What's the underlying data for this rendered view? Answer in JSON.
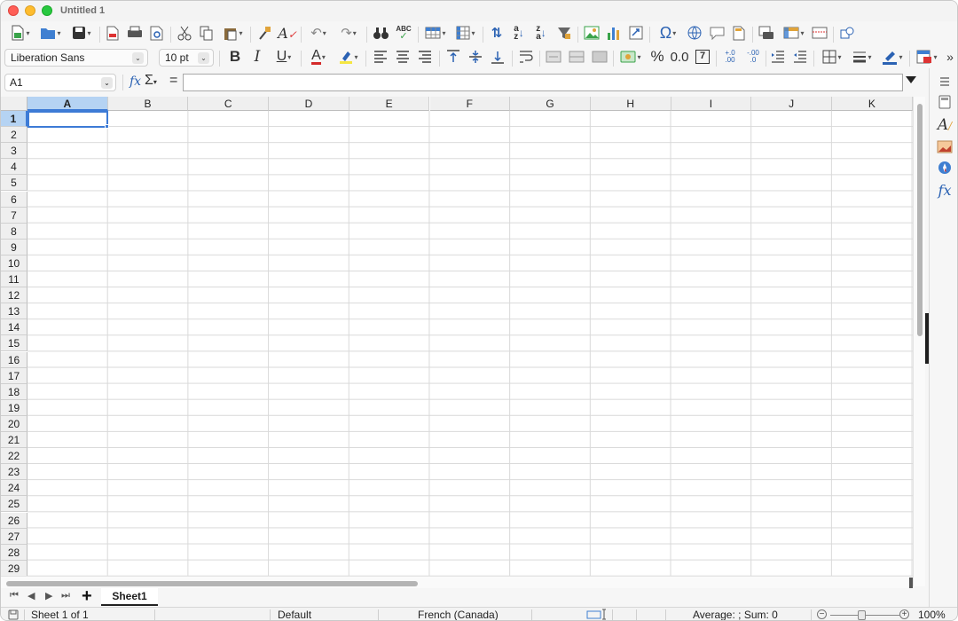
{
  "window": {
    "title": "Untitled 1"
  },
  "toolbar_standard": {
    "icons": [
      "new-document-icon",
      "open-folder-icon",
      "save-icon",
      "export-pdf-icon",
      "print-icon",
      "print-preview-icon",
      "cut-icon",
      "copy-icon",
      "paste-icon",
      "clone-formatting-icon",
      "clear-formatting-icon",
      "undo-icon",
      "redo-icon",
      "find-replace-icon",
      "spelling-icon",
      "row-icon",
      "column-icon",
      "sort-icon",
      "sort-ascending-icon",
      "sort-descending-icon",
      "autofilter-icon",
      "image-icon",
      "chart-icon",
      "pivot-table-icon",
      "special-character-icon",
      "hyperlink-icon",
      "comment-icon",
      "headers-footers-icon",
      "define-print-area-icon",
      "freeze-rows-columns-icon",
      "split-window-icon",
      "show-draw-functions-icon"
    ],
    "labels": {
      "spelling_text": "ABC",
      "sort_az_text": "A\nZ",
      "omega": "Ω"
    }
  },
  "toolbar_formatting": {
    "font_name": "Liberation Sans",
    "font_size": "10 pt",
    "bold": "B",
    "italic": "I",
    "underline": "U",
    "font_color_letter": "A",
    "font_color": "#d42a2a",
    "highlight_color": "#f5e642",
    "percent": "%",
    "decimal_format": "0.0",
    "number_format": "7",
    "add_decimal": "+.0\n.00",
    "remove_decimal": "-.00\n.0",
    "more": "»"
  },
  "formula_bar": {
    "name_box": "A1",
    "fx": "fx",
    "sigma": "Σ",
    "equals": "=",
    "input_value": ""
  },
  "grid": {
    "columns": [
      "A",
      "B",
      "C",
      "D",
      "E",
      "F",
      "G",
      "H",
      "I",
      "J",
      "K"
    ],
    "rows": [
      "1",
      "2",
      "3",
      "4",
      "5",
      "6",
      "7",
      "8",
      "9",
      "10",
      "11",
      "12",
      "13",
      "14",
      "15",
      "16",
      "17",
      "18",
      "19",
      "20",
      "21",
      "22",
      "23",
      "24",
      "25",
      "26",
      "27",
      "28",
      "29"
    ],
    "active_column": "A",
    "active_row": "1",
    "selection_color": "#3d7bd6",
    "header_highlight": "#b5d3f3"
  },
  "sheet_tabs": {
    "add_label": "+",
    "tabs": [
      "Sheet1"
    ]
  },
  "status_bar": {
    "sheet_position": "Sheet 1 of 1",
    "page_style": "Default",
    "language": "French (Canada)",
    "summary": "Average: ; Sum: 0",
    "zoom": "100%",
    "zoom_minus": "−",
    "zoom_plus": "+"
  },
  "sidebar": {
    "icons": [
      "sidebar-menu-icon",
      "properties-icon",
      "styles-icon",
      "gallery-icon",
      "navigator-icon",
      "functions-icon"
    ],
    "functions_label": "fx"
  }
}
